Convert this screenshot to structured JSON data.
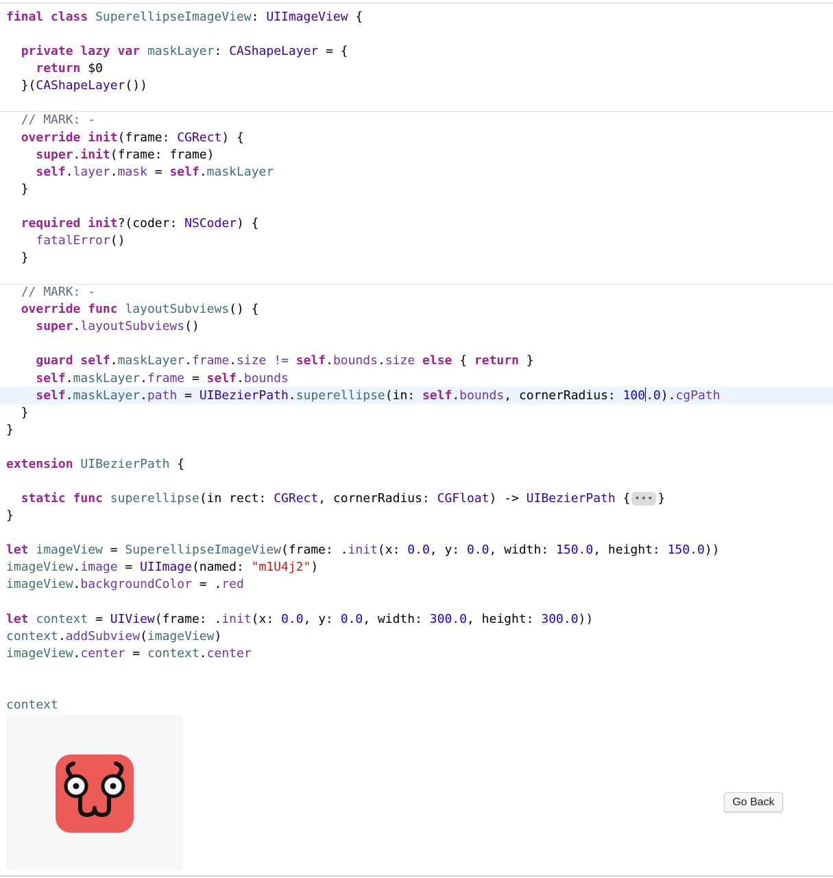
{
  "code_lines": [
    [
      {
        "t": "final",
        "c": "kw"
      },
      {
        "t": " "
      },
      {
        "t": "class",
        "c": "kw"
      },
      {
        "t": " "
      },
      {
        "t": "SuperellipseImageView",
        "c": "pt"
      },
      {
        "t": ": "
      },
      {
        "t": "UIImageView",
        "c": "ty"
      },
      {
        "t": " {"
      }
    ],
    [],
    [
      {
        "t": "  "
      },
      {
        "t": "private",
        "c": "kw"
      },
      {
        "t": " "
      },
      {
        "t": "lazy",
        "c": "kw"
      },
      {
        "t": " "
      },
      {
        "t": "var",
        "c": "kw"
      },
      {
        "t": " "
      },
      {
        "t": "maskLayer",
        "c": "pt"
      },
      {
        "t": ": "
      },
      {
        "t": "CAShapeLayer",
        "c": "ty"
      },
      {
        "t": " = {"
      }
    ],
    [
      {
        "t": "    "
      },
      {
        "t": "return",
        "c": "kw"
      },
      {
        "t": " $0"
      }
    ],
    [
      {
        "t": "  }("
      },
      {
        "t": "CAShapeLayer",
        "c": "ty"
      },
      {
        "t": "())"
      }
    ],
    [],
    [
      {
        "t": "  "
      },
      {
        "t": "// MARK: -",
        "c": "cm"
      }
    ],
    [
      {
        "t": "  "
      },
      {
        "t": "override",
        "c": "kw"
      },
      {
        "t": " "
      },
      {
        "t": "init",
        "c": "kw"
      },
      {
        "t": "(frame: "
      },
      {
        "t": "CGRect",
        "c": "ty"
      },
      {
        "t": ") {"
      }
    ],
    [
      {
        "t": "    "
      },
      {
        "t": "super",
        "c": "kw"
      },
      {
        "t": "."
      },
      {
        "t": "init",
        "c": "kw"
      },
      {
        "t": "(frame: frame)"
      }
    ],
    [
      {
        "t": "    "
      },
      {
        "t": "self",
        "c": "kw"
      },
      {
        "t": "."
      },
      {
        "t": "layer",
        "c": "pm"
      },
      {
        "t": "."
      },
      {
        "t": "mask",
        "c": "pm"
      },
      {
        "t": " = "
      },
      {
        "t": "self",
        "c": "kw"
      },
      {
        "t": "."
      },
      {
        "t": "maskLayer",
        "c": "pt"
      }
    ],
    [
      {
        "t": "  }"
      }
    ],
    [],
    [
      {
        "t": "  "
      },
      {
        "t": "required",
        "c": "kw"
      },
      {
        "t": " "
      },
      {
        "t": "init",
        "c": "kw"
      },
      {
        "t": "?(coder: "
      },
      {
        "t": "NSCoder",
        "c": "ty"
      },
      {
        "t": ") {"
      }
    ],
    [
      {
        "t": "    "
      },
      {
        "t": "fatalError",
        "c": "pm"
      },
      {
        "t": "()"
      }
    ],
    [
      {
        "t": "  }"
      }
    ],
    [],
    [
      {
        "t": "  "
      },
      {
        "t": "// MARK: -",
        "c": "cm"
      }
    ],
    [
      {
        "t": "  "
      },
      {
        "t": "override",
        "c": "kw"
      },
      {
        "t": " "
      },
      {
        "t": "func",
        "c": "kw"
      },
      {
        "t": " "
      },
      {
        "t": "layoutSubviews",
        "c": "pt"
      },
      {
        "t": "() {"
      }
    ],
    [
      {
        "t": "    "
      },
      {
        "t": "super",
        "c": "kw"
      },
      {
        "t": "."
      },
      {
        "t": "layoutSubviews",
        "c": "pm"
      },
      {
        "t": "()"
      }
    ],
    [],
    [
      {
        "t": "    "
      },
      {
        "t": "guard",
        "c": "kw"
      },
      {
        "t": " "
      },
      {
        "t": "self",
        "c": "kw"
      },
      {
        "t": "."
      },
      {
        "t": "maskLayer",
        "c": "pt"
      },
      {
        "t": "."
      },
      {
        "t": "frame",
        "c": "pm"
      },
      {
        "t": "."
      },
      {
        "t": "size",
        "c": "pm"
      },
      {
        "t": " "
      },
      {
        "t": "!=",
        "c": "pm"
      },
      {
        "t": " "
      },
      {
        "t": "self",
        "c": "kw"
      },
      {
        "t": "."
      },
      {
        "t": "bounds",
        "c": "pm"
      },
      {
        "t": "."
      },
      {
        "t": "size",
        "c": "pm"
      },
      {
        "t": " "
      },
      {
        "t": "else",
        "c": "kw"
      },
      {
        "t": " { "
      },
      {
        "t": "return",
        "c": "kw"
      },
      {
        "t": " }"
      }
    ],
    [
      {
        "t": "    "
      },
      {
        "t": "self",
        "c": "kw"
      },
      {
        "t": "."
      },
      {
        "t": "maskLayer",
        "c": "pt"
      },
      {
        "t": "."
      },
      {
        "t": "frame",
        "c": "pm"
      },
      {
        "t": " = "
      },
      {
        "t": "self",
        "c": "kw"
      },
      {
        "t": "."
      },
      {
        "t": "bounds",
        "c": "pm"
      }
    ],
    [
      {
        "t": "    "
      },
      {
        "t": "self",
        "c": "kw"
      },
      {
        "t": "."
      },
      {
        "t": "maskLayer",
        "c": "pt"
      },
      {
        "t": "."
      },
      {
        "t": "path",
        "c": "pm"
      },
      {
        "t": " = "
      },
      {
        "t": "UIBezierPath",
        "c": "ty"
      },
      {
        "t": "."
      },
      {
        "t": "superellipse",
        "c": "pt"
      },
      {
        "t": "(in: "
      },
      {
        "t": "self",
        "c": "kw"
      },
      {
        "t": "."
      },
      {
        "t": "bounds",
        "c": "pm"
      },
      {
        "t": ", cornerRadius: "
      },
      {
        "t": "100",
        "c": "nm"
      },
      {
        "cursor": true
      },
      {
        "t": ".0",
        "c": "nm"
      },
      {
        "t": ")."
      },
      {
        "t": "cgPath",
        "c": "pm"
      }
    ],
    [
      {
        "t": "  }"
      }
    ],
    [
      {
        "t": "}"
      }
    ],
    [],
    [
      {
        "t": "extension",
        "c": "kw"
      },
      {
        "t": " "
      },
      {
        "t": "UIBezierPath",
        "c": "pt"
      },
      {
        "t": " {"
      }
    ],
    [],
    [
      {
        "t": "  "
      },
      {
        "t": "static",
        "c": "kw"
      },
      {
        "t": " "
      },
      {
        "t": "func",
        "c": "kw"
      },
      {
        "t": " "
      },
      {
        "t": "superellipse",
        "c": "pt"
      },
      {
        "t": "(in rect: "
      },
      {
        "t": "CGRect",
        "c": "ty"
      },
      {
        "t": ", cornerRadius: "
      },
      {
        "t": "CGFloat",
        "c": "ty"
      },
      {
        "t": ") -> "
      },
      {
        "t": "UIBezierPath",
        "c": "ty"
      },
      {
        "t": " {"
      },
      {
        "fold": "•••"
      },
      {
        "t": "}"
      }
    ],
    [
      {
        "t": "}"
      }
    ],
    [],
    [
      {
        "t": "let",
        "c": "kw"
      },
      {
        "t": " "
      },
      {
        "t": "imageView",
        "c": "pt"
      },
      {
        "t": " = "
      },
      {
        "t": "SuperellipseImageView",
        "c": "pt"
      },
      {
        "t": "(frame: ."
      },
      {
        "t": "init",
        "c": "pm"
      },
      {
        "t": "(x: "
      },
      {
        "t": "0.0",
        "c": "nm"
      },
      {
        "t": ", y: "
      },
      {
        "t": "0.0",
        "c": "nm"
      },
      {
        "t": ", width: "
      },
      {
        "t": "150.0",
        "c": "nm"
      },
      {
        "t": ", height: "
      },
      {
        "t": "150.0",
        "c": "nm"
      },
      {
        "t": "))"
      }
    ],
    [
      {
        "t": "imageView",
        "c": "pt"
      },
      {
        "t": "."
      },
      {
        "t": "image",
        "c": "pm"
      },
      {
        "t": " = "
      },
      {
        "t": "UIImage",
        "c": "ty"
      },
      {
        "t": "(named: "
      },
      {
        "t": "\"m1U4j2\"",
        "c": "st"
      },
      {
        "t": ")"
      }
    ],
    [
      {
        "t": "imageView",
        "c": "pt"
      },
      {
        "t": "."
      },
      {
        "t": "backgroundColor",
        "c": "pm"
      },
      {
        "t": " = ."
      },
      {
        "t": "red",
        "c": "pm"
      }
    ],
    [],
    [
      {
        "t": "let",
        "c": "kw"
      },
      {
        "t": " "
      },
      {
        "t": "context",
        "c": "pt"
      },
      {
        "t": " = "
      },
      {
        "t": "UIView",
        "c": "ty"
      },
      {
        "t": "(frame: ."
      },
      {
        "t": "init",
        "c": "pm"
      },
      {
        "t": "(x: "
      },
      {
        "t": "0.0",
        "c": "nm"
      },
      {
        "t": ", y: "
      },
      {
        "t": "0.0",
        "c": "nm"
      },
      {
        "t": ", width: "
      },
      {
        "t": "300.0",
        "c": "nm"
      },
      {
        "t": ", height: "
      },
      {
        "t": "300.0",
        "c": "nm"
      },
      {
        "t": "))"
      }
    ],
    [
      {
        "t": "context",
        "c": "pt"
      },
      {
        "t": "."
      },
      {
        "t": "addSubview",
        "c": "pm"
      },
      {
        "t": "("
      },
      {
        "t": "imageView",
        "c": "pt"
      },
      {
        "t": ")"
      }
    ],
    [
      {
        "t": "imageView",
        "c": "pt"
      },
      {
        "t": "."
      },
      {
        "t": "center",
        "c": "pm"
      },
      {
        "t": " = "
      },
      {
        "t": "context",
        "c": "pt"
      },
      {
        "t": "."
      },
      {
        "t": "center",
        "c": "pm"
      }
    ],
    [],
    [],
    [
      {
        "t": "context",
        "c": "pt"
      }
    ]
  ],
  "highlighted_line": 22,
  "go_back_label": "Go Back",
  "preview": {
    "icon_name": "superellipse-face-icon",
    "icon_color": "#ec5b55",
    "background": "#f5f6f7"
  },
  "colors": {
    "keyword": "#9b2393",
    "type": "#3900a0",
    "project": "#3e6d74",
    "member": "#6c36a9",
    "number": "#1c00cf",
    "string": "#c41a16",
    "comment": "#5d6c79"
  }
}
